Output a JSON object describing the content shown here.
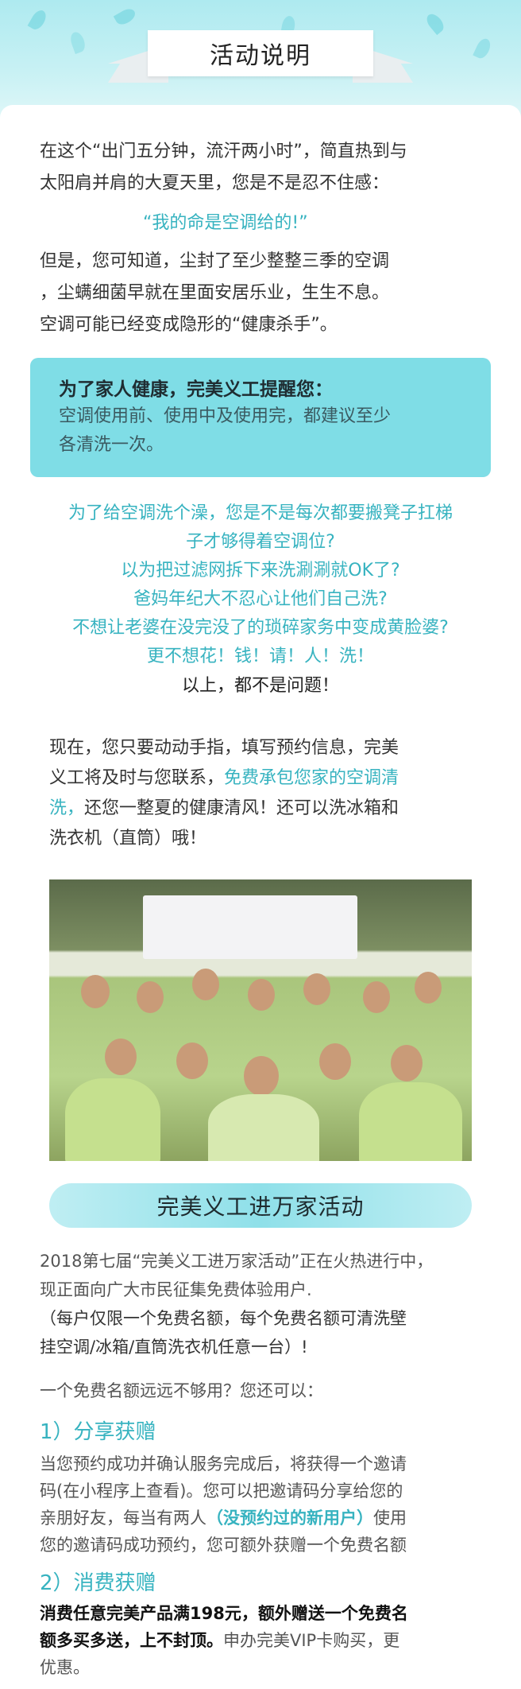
{
  "header": {
    "title": "活动说明"
  },
  "intro": {
    "line1": "在这个“出门五分钟，流汗两小时”，简直热到与",
    "line2": "太阳肩并肩的大夏天里，您是不是忍不住感：",
    "quote": "“我的命是空调给的!”",
    "line3": "但是，您可知道，尘封了至少整整三季的空调",
    "line4": "，尘螨细菌早就在里面安居乐业，生生不息。",
    "line5": "空调可能已经变成隐形的“健康杀手”。"
  },
  "notice": {
    "heading": "为了家人健康，完美义工提醒您：",
    "body1": "空调使用前、使用中及使用完，都建议至少",
    "body2": "各清洗一次。"
  },
  "questions": [
    "为了给空调洗个澡，您是不是每次都要搬凳子扛梯",
    "子才够得着空调位?",
    "以为把过滤网拆下来洗涮涮就OK了?",
    "爸妈年纪大不忍心让他们自己洗?",
    "不想让老婆在没完没了的琐碎家务中变成黄脸婆?",
    "更不想花！钱！请！人！洗！"
  ],
  "no_problem": "以上，都不是问题！",
  "action": {
    "line1": "现在，您只要动动手指，填写预约信息，完美",
    "line2a": "义工将及时与您联系，",
    "line2b": "免费承包您家的空调清",
    "line3a": "洗，",
    "line3b": "还您一整夏的健康清风！还可以洗冰箱和",
    "line4": "洗衣机（直筒）哦！"
  },
  "photo": {
    "alt": "完美义工合影"
  },
  "campaign": {
    "title": "完美义工进万家活动",
    "line1": "2018第七届“完美义工进万家活动”正在火热进行中，",
    "line2": "现正面向广大市民征集免费体验用户.",
    "line3": "（每户仅限一个免费名额，每个免费名额可清洗壁",
    "line4": "挂空调/冰箱/直筒洗衣机任意一台）!",
    "line5": "一个免费名额远远不够用？您还可以："
  },
  "share": {
    "heading": "1）分享获赠",
    "line1": "当您预约成功并确认服务完成后，将获得一个邀请",
    "line2": "码(在小程序上查看)。您可以把邀请码分享给您的",
    "line3a": "亲朋好友，每当有两人",
    "line3b": "（没预约过的新用户）",
    "line3c": "使用",
    "line4": "您的邀请码成功预约，您可额外获赠一个免费名额"
  },
  "consume": {
    "heading": "2）消费获赠",
    "line1": "消费任意完美产品满198元，额外赠送一个免费名",
    "line2a": "额多买多送，上不封顶。",
    "line2b": "申办完美VIP卡购买，更",
    "line3": "优惠。"
  },
  "colors": {
    "teal": "#37b3c0",
    "notice_bg": "#7fdde6",
    "hero_bg": "#aeeaf0"
  }
}
